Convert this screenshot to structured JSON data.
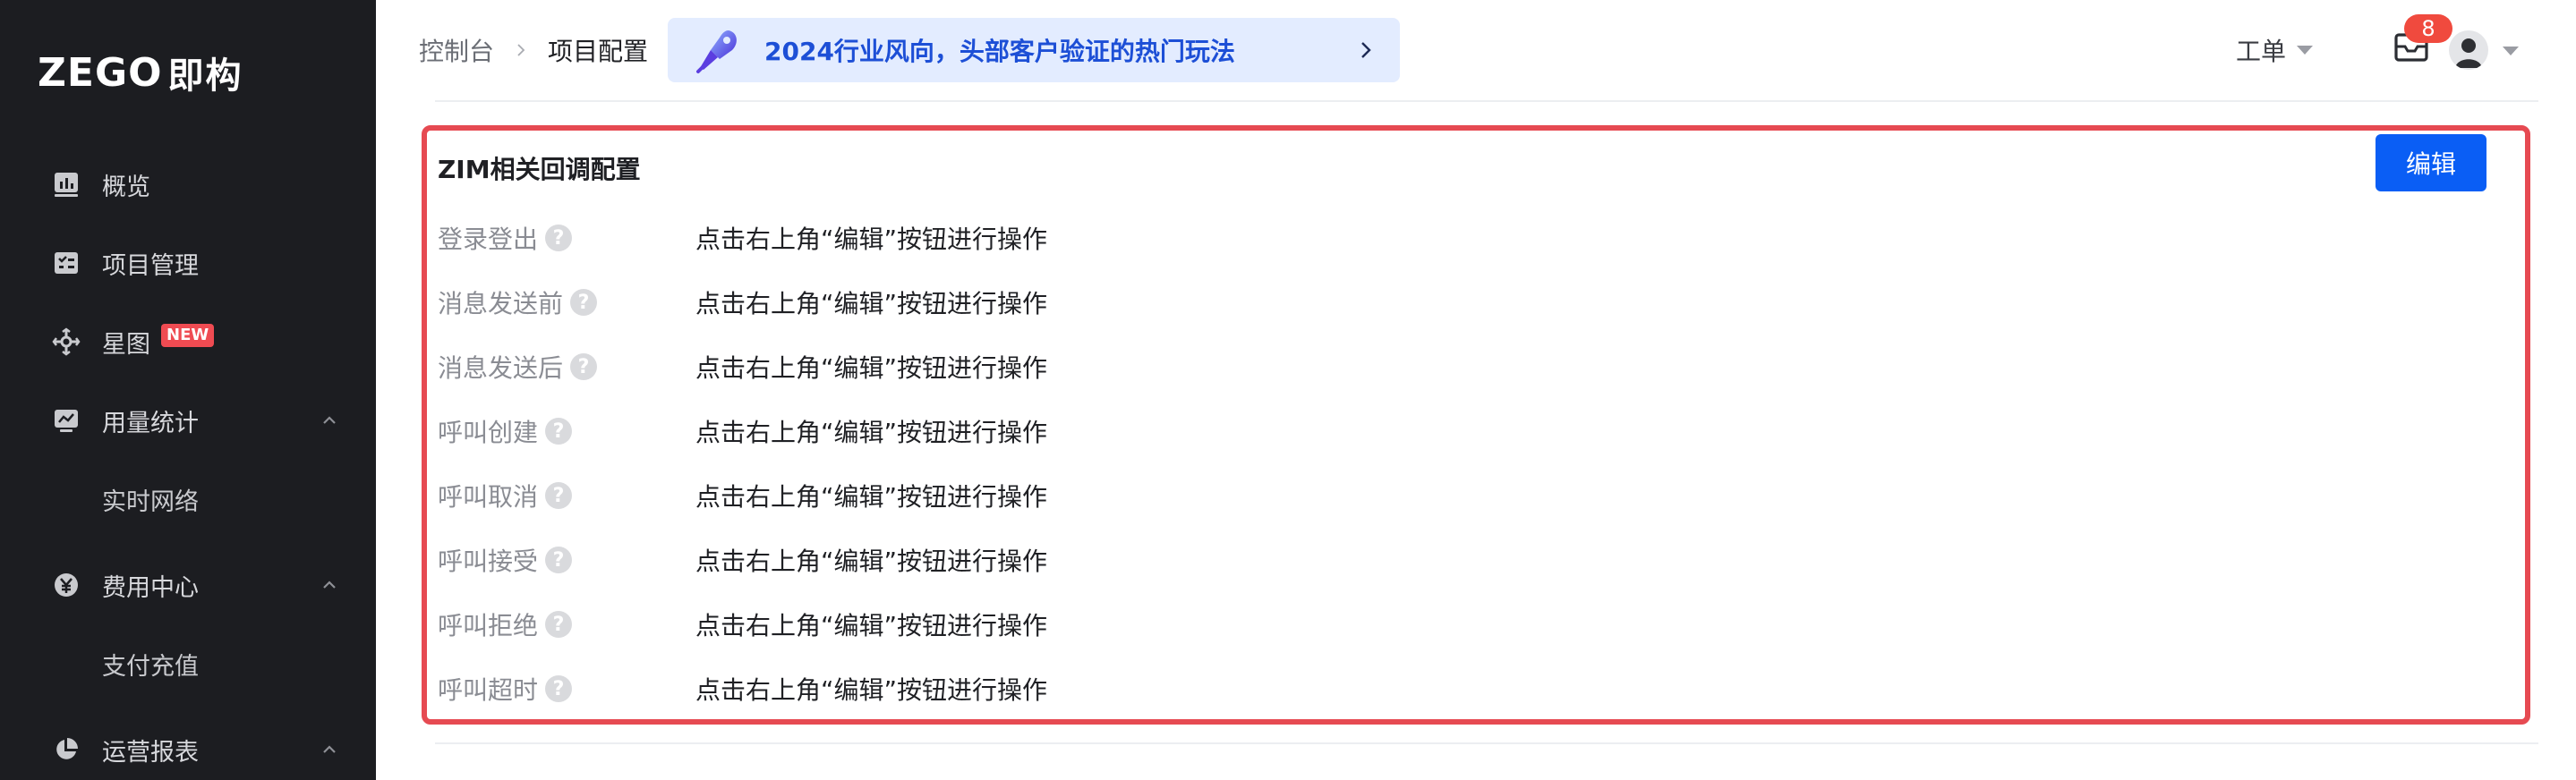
{
  "logo": {
    "brand": "ZEGO",
    "cn": "即构"
  },
  "sidebar": {
    "items": [
      {
        "label": "概览",
        "icon": "dashboard-icon"
      },
      {
        "label": "项目管理",
        "icon": "project-icon"
      },
      {
        "label": "星图",
        "icon": "star-map-icon",
        "badge": "NEW"
      },
      {
        "label": "用量统计",
        "icon": "usage-chart-icon",
        "expanded": true
      },
      {
        "label": "实时网络",
        "sub": true
      },
      {
        "label": "费用中心",
        "icon": "yen-icon",
        "expanded": true
      },
      {
        "label": "支付充值",
        "sub": true
      },
      {
        "label": "运营报表",
        "icon": "pie-chart-icon",
        "expanded": true
      }
    ]
  },
  "header": {
    "breadcrumb": {
      "home": "控制台",
      "current": "项目配置"
    },
    "promo": {
      "text": "2024行业风向，头部客户验证的热门玩法"
    },
    "ticket_label": "工单",
    "mail_count": "8"
  },
  "panel": {
    "title": "ZIM相关回调配置",
    "edit_label": "编辑",
    "rows": [
      {
        "label": "登录登出",
        "value": "点击右上角“编辑”按钮进行操作"
      },
      {
        "label": "消息发送前",
        "value": "点击右上角“编辑”按钮进行操作"
      },
      {
        "label": "消息发送后",
        "value": "点击右上角“编辑”按钮进行操作"
      },
      {
        "label": "呼叫创建",
        "value": "点击右上角“编辑”按钮进行操作"
      },
      {
        "label": "呼叫取消",
        "value": "点击右上角“编辑”按钮进行操作"
      },
      {
        "label": "呼叫接受",
        "value": "点击右上角“编辑”按钮进行操作"
      },
      {
        "label": "呼叫拒绝",
        "value": "点击右上角“编辑”按钮进行操作"
      },
      {
        "label": "呼叫超时",
        "value": "点击右上角“编辑”按钮进行操作"
      }
    ]
  },
  "colors": {
    "sidebar_bg": "#1c1d21",
    "primary": "#0a5ef5",
    "highlight_border": "#e64a52",
    "badge": "#f04a3e"
  }
}
